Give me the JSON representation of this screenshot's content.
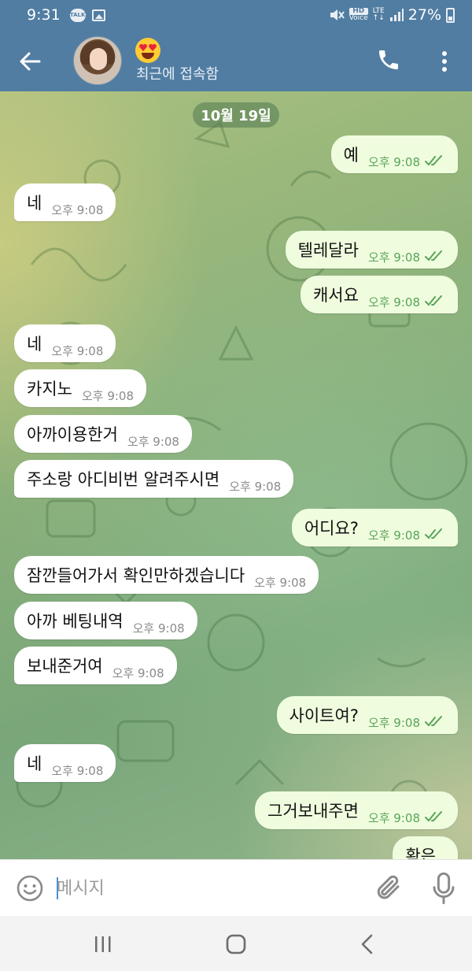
{
  "status_bar": {
    "time": "9:31",
    "talk_badge": "TALK",
    "hd_label": "HD",
    "voice_label": "Voice",
    "lte_label": "LTE",
    "battery": "27%"
  },
  "header": {
    "status": "최근에 접속함",
    "emoji": "heart-eyes"
  },
  "date_label": "10월 19일",
  "messages": [
    {
      "dir": "out",
      "text": "예",
      "time": "오후 9:08"
    },
    {
      "dir": "in",
      "text": "네",
      "time": "오후 9:08"
    },
    {
      "dir": "out",
      "text": "텔레달라",
      "time": "오후 9:08"
    },
    {
      "dir": "out",
      "text": "캐서요",
      "time": "오후 9:08"
    },
    {
      "dir": "in",
      "text": "네",
      "time": "오후 9:08"
    },
    {
      "dir": "in",
      "text": "카지노",
      "time": "오후 9:08"
    },
    {
      "dir": "in",
      "text": "아까이용한거",
      "time": "오후 9:08"
    },
    {
      "dir": "in",
      "text": "주소랑 아디비번 알려주시면",
      "time": "오후 9:08"
    },
    {
      "dir": "out",
      "text": "어디요?",
      "time": "오후 9:08"
    },
    {
      "dir": "in",
      "text": "잠깐들어가서 확인만하겠습니다",
      "time": "오후 9:08"
    },
    {
      "dir": "in",
      "text": "아까 베팅내역",
      "time": "오후 9:08"
    },
    {
      "dir": "in",
      "text": "보내준거여",
      "time": "오후 9:08"
    },
    {
      "dir": "out",
      "text": "사이트여?",
      "time": "오후 9:08"
    },
    {
      "dir": "in",
      "text": "네",
      "time": "오후 9:08"
    },
    {
      "dir": "out",
      "text": "그거보내주면",
      "time": "오후 9:08"
    },
    {
      "dir": "out",
      "text": "확은",
      "time": ""
    }
  ],
  "input": {
    "placeholder": "메시지",
    "value": ""
  },
  "colors": {
    "header_bg": "#517da2",
    "outgoing_bubble": "#effdde",
    "incoming_bubble": "#ffffff",
    "read_ticks": "#5aa35a"
  },
  "icons": [
    "back-arrow",
    "phone",
    "more-vertical",
    "smiley",
    "paperclip",
    "microphone",
    "recent-apps",
    "home",
    "nav-back"
  ]
}
